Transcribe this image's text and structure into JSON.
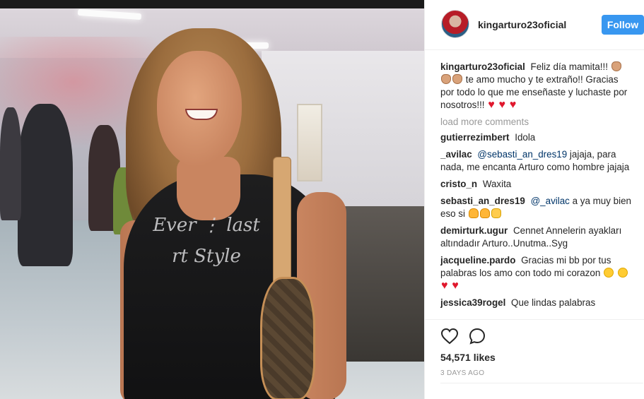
{
  "post": {
    "username": "kingarturo23oficial",
    "follow_label": "Follow",
    "caption": {
      "username": "kingarturo23oficial",
      "text_1": "Feliz día mamita!!!",
      "text_2": "te amo mucho y te extraño!! Gracias por todo lo que me enseñaste y luchaste por nosotros!!!"
    },
    "load_more": "load more comments",
    "comments": [
      {
        "user": "gutierrezimbert",
        "text": "Idola"
      },
      {
        "user": "_avilac",
        "mention": "@sebasti_an_dres19",
        "text": "jajaja, para nada, me encanta Arturo como hombre jajaja"
      },
      {
        "user": "cristo_n",
        "text": "Waxita"
      },
      {
        "user": "sebasti_an_dres19",
        "mention": "@_avilac",
        "text": "a ya muy bien eso si"
      },
      {
        "user": "demirturk.ugur",
        "text": "Cennet Annelerin ayakları altındadır Arturo..Unutma..Syg"
      },
      {
        "user": "jacqueline.pardo",
        "text": "Gracias mi bb por tus palabras los amo con todo mi corazon"
      },
      {
        "user": "jessica39rogel",
        "text": "Que lindas palabras"
      }
    ],
    "likes": "54,571 likes",
    "timestamp": "3 DAYS AGO",
    "photo_text": {
      "line1": "Ever ⋮ last",
      "line2": "rt Style"
    },
    "icons": {
      "like": "heart-outline-icon",
      "comment": "comment-bubble-icon"
    },
    "colors": {
      "follow_button": "#3897f0",
      "heart_emoji": "#e0182d",
      "muted_text": "#999999"
    }
  }
}
